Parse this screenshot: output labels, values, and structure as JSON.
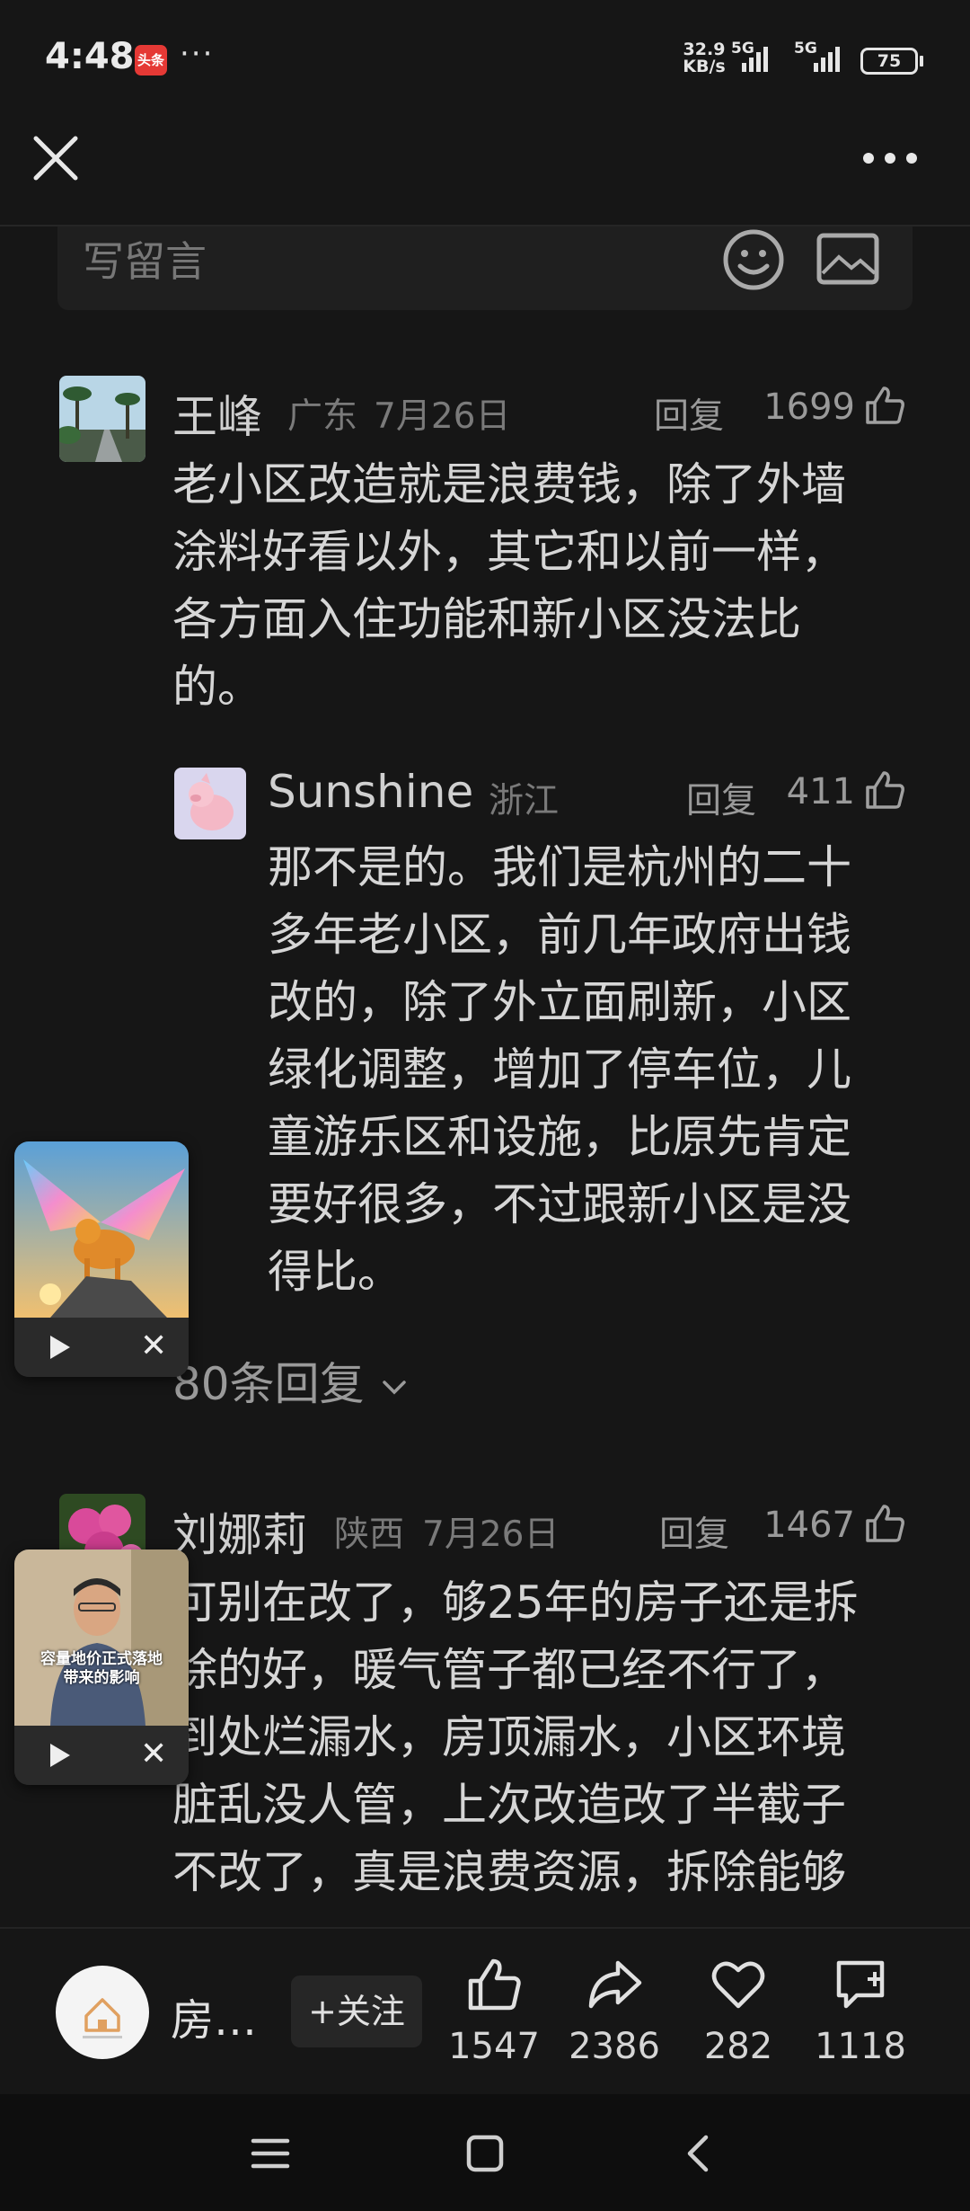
{
  "status_bar": {
    "time": "4:48",
    "app_badge": "头条",
    "more_dots": "···",
    "net_speed_value": "32.9",
    "net_speed_unit": "KB/s",
    "signal1_label": "5G",
    "signal2_label": "5G",
    "battery": "75"
  },
  "comment_input": {
    "placeholder": "写留言"
  },
  "comments": [
    {
      "username": "王峰",
      "region": "广东",
      "date": "7月26日",
      "reply_label": "回复",
      "likes": "1699",
      "lines": [
        "老小区改造就是浪费钱，除了外墙",
        "涂料好看以外，其它和以前一样，",
        "各方面入住功能和新小区没法比",
        "的。"
      ],
      "reply": {
        "username": "Sunshine",
        "region": "浙江",
        "reply_label": "回复",
        "likes": "411",
        "lines": [
          "那不是的。我们是杭州的二十",
          "多年老小区，前几年政府出钱",
          "改的，除了外立面刷新，小区",
          "绿化调整，增加了停车位，儿",
          "童游乐区和设施，比原先肯定",
          "要好很多，不过跟新小区是没",
          "得比。"
        ]
      },
      "more_replies": "80条回复"
    },
    {
      "username": "刘娜莉",
      "region": "陕西",
      "date": "7月26日",
      "reply_label": "回复",
      "likes": "1467",
      "lines": [
        "可别在改了，够25年的房子还是拆",
        "除的好，暖气管子都已经不行了，",
        "到处烂漏水，房顶漏水，小区环境",
        "脏乱没人管，上次改造改了半截子",
        "不改了，真是浪费资源，拆除能够"
      ]
    }
  ],
  "mini_players": [
    {
      "subtitle": ""
    },
    {
      "subtitle": "容量地价正式落地\n带来的影响"
    }
  ],
  "bottom_bar": {
    "source_name": "房…",
    "follow_label": "+关注",
    "like_count": "1547",
    "share_count": "2386",
    "favorite_count": "282",
    "comment_count": "1118"
  },
  "colors": {
    "background": "#161616",
    "text": "#d6d6d6",
    "muted": "#7a7a7a"
  }
}
